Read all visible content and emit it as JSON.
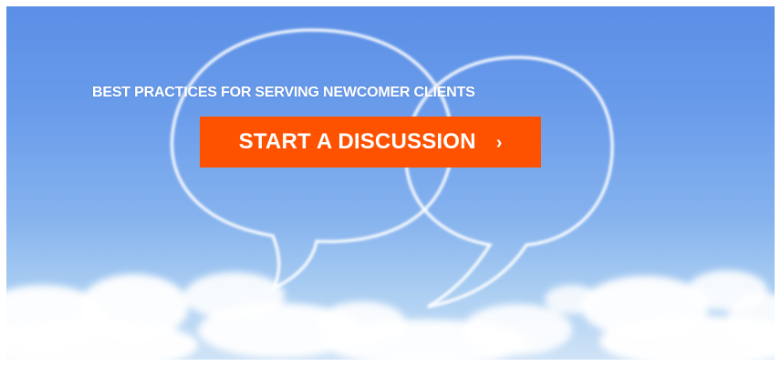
{
  "banner": {
    "headline": "BEST PRACTICES FOR SERVING NEWCOMER CLIENTS",
    "cta_label": "START A DISCUSSION",
    "cta_chevron": "›",
    "cta_color": "#ff5200",
    "sky_color": "#5b8fe6",
    "illustration": "speech-bubbles-cloud-icon"
  }
}
